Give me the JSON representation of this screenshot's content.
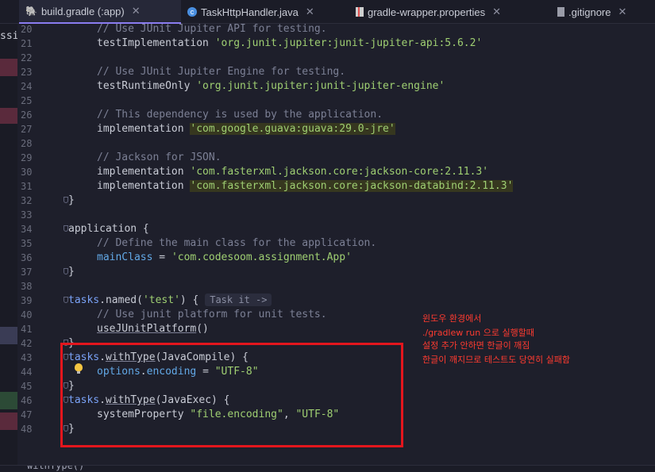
{
  "tabs": [
    {
      "label": "build.gradle (:app)",
      "icon": "gradle-elephant-icon",
      "active": true
    },
    {
      "label": "TaskHttpHandler.java",
      "icon": "java-class-icon",
      "active": false
    },
    {
      "label": "gradle-wrapper.properties",
      "icon": "properties-file-icon",
      "active": false
    },
    {
      "label": ".gitignore",
      "icon": "gitignore-file-icon",
      "active": false
    }
  ],
  "left_fragment": "ssi",
  "line_numbers": [
    "20",
    "21",
    "22",
    "23",
    "24",
    "25",
    "26",
    "27",
    "28",
    "29",
    "30",
    "31",
    "32",
    "33",
    "34",
    "35",
    "36",
    "37",
    "38",
    "39",
    "40",
    "41",
    "42",
    "43",
    "44",
    "45",
    "46",
    "47",
    "48"
  ],
  "code": {
    "l20": "// Use JUnit Jupiter API for testing.",
    "l21_kw": "testImplementation",
    "l21_str": "'org.junit.jupiter:junit-jupiter-api:5.6.2'",
    "l23": "// Use JUnit Jupiter Engine for testing.",
    "l24_kw": "testRuntimeOnly",
    "l24_str": "'org.junit.jupiter:junit-jupiter-engine'",
    "l26": "// This dependency is used by the application.",
    "l27_kw": "implementation",
    "l27_str": "'com.google.guava:guava:29.0-jre'",
    "l29": "// Jackson for JSON.",
    "l30_kw": "implementation",
    "l30_str": "'com.fasterxml.jackson.core:jackson-core:2.11.3'",
    "l31_kw": "implementation",
    "l31_str": "'com.fasterxml.jackson.core:jackson-databind:2.11.3'",
    "l32": "}",
    "l34": "application {",
    "l35": "// Define the main class for the application.",
    "l36_prop": "mainClass",
    "l36_eq": " = ",
    "l36_str": "'com.codesoom.assignment.App'",
    "l37": "}",
    "l39_a": "tasks",
    "l39_b": ".named(",
    "l39_str": "'test'",
    "l39_c": ") { ",
    "l39_hint": "Task it ->",
    "l40": "// Use junit platform for unit tests.",
    "l41": "useJUnitPlatform",
    "l41_b": "()",
    "l42": "}",
    "l43_a": "tasks",
    "l43_b": ".",
    "l43_fn": "withType",
    "l43_c": "(JavaCompile) {",
    "l44_a": "options",
    "l44_b": ".",
    "l44_c": "encoding",
    "l44_d": " = ",
    "l44_str": "\"UTF-8\"",
    "l45": "}",
    "l46_a": "tasks",
    "l46_b": ".",
    "l46_fn": "withType",
    "l46_c": "(JavaExec) {",
    "l47_a": "systemProperty",
    "l47_str1": "\"file.encoding\"",
    "l47_sep": ", ",
    "l47_str2": "\"UTF-8\"",
    "l48": "}"
  },
  "annotation": [
    "윈도우 환경에서",
    "./gradlew run 으로 실행할때",
    "설정 추가 안하면 한글이 깨짐",
    "한글이 깨지므로 테스트도 당연히 실패함"
  ],
  "status_text": "withType()",
  "colors": {
    "annotation": "#ff3b30",
    "box": "#e3161d",
    "accent": "#8a7cf0"
  }
}
